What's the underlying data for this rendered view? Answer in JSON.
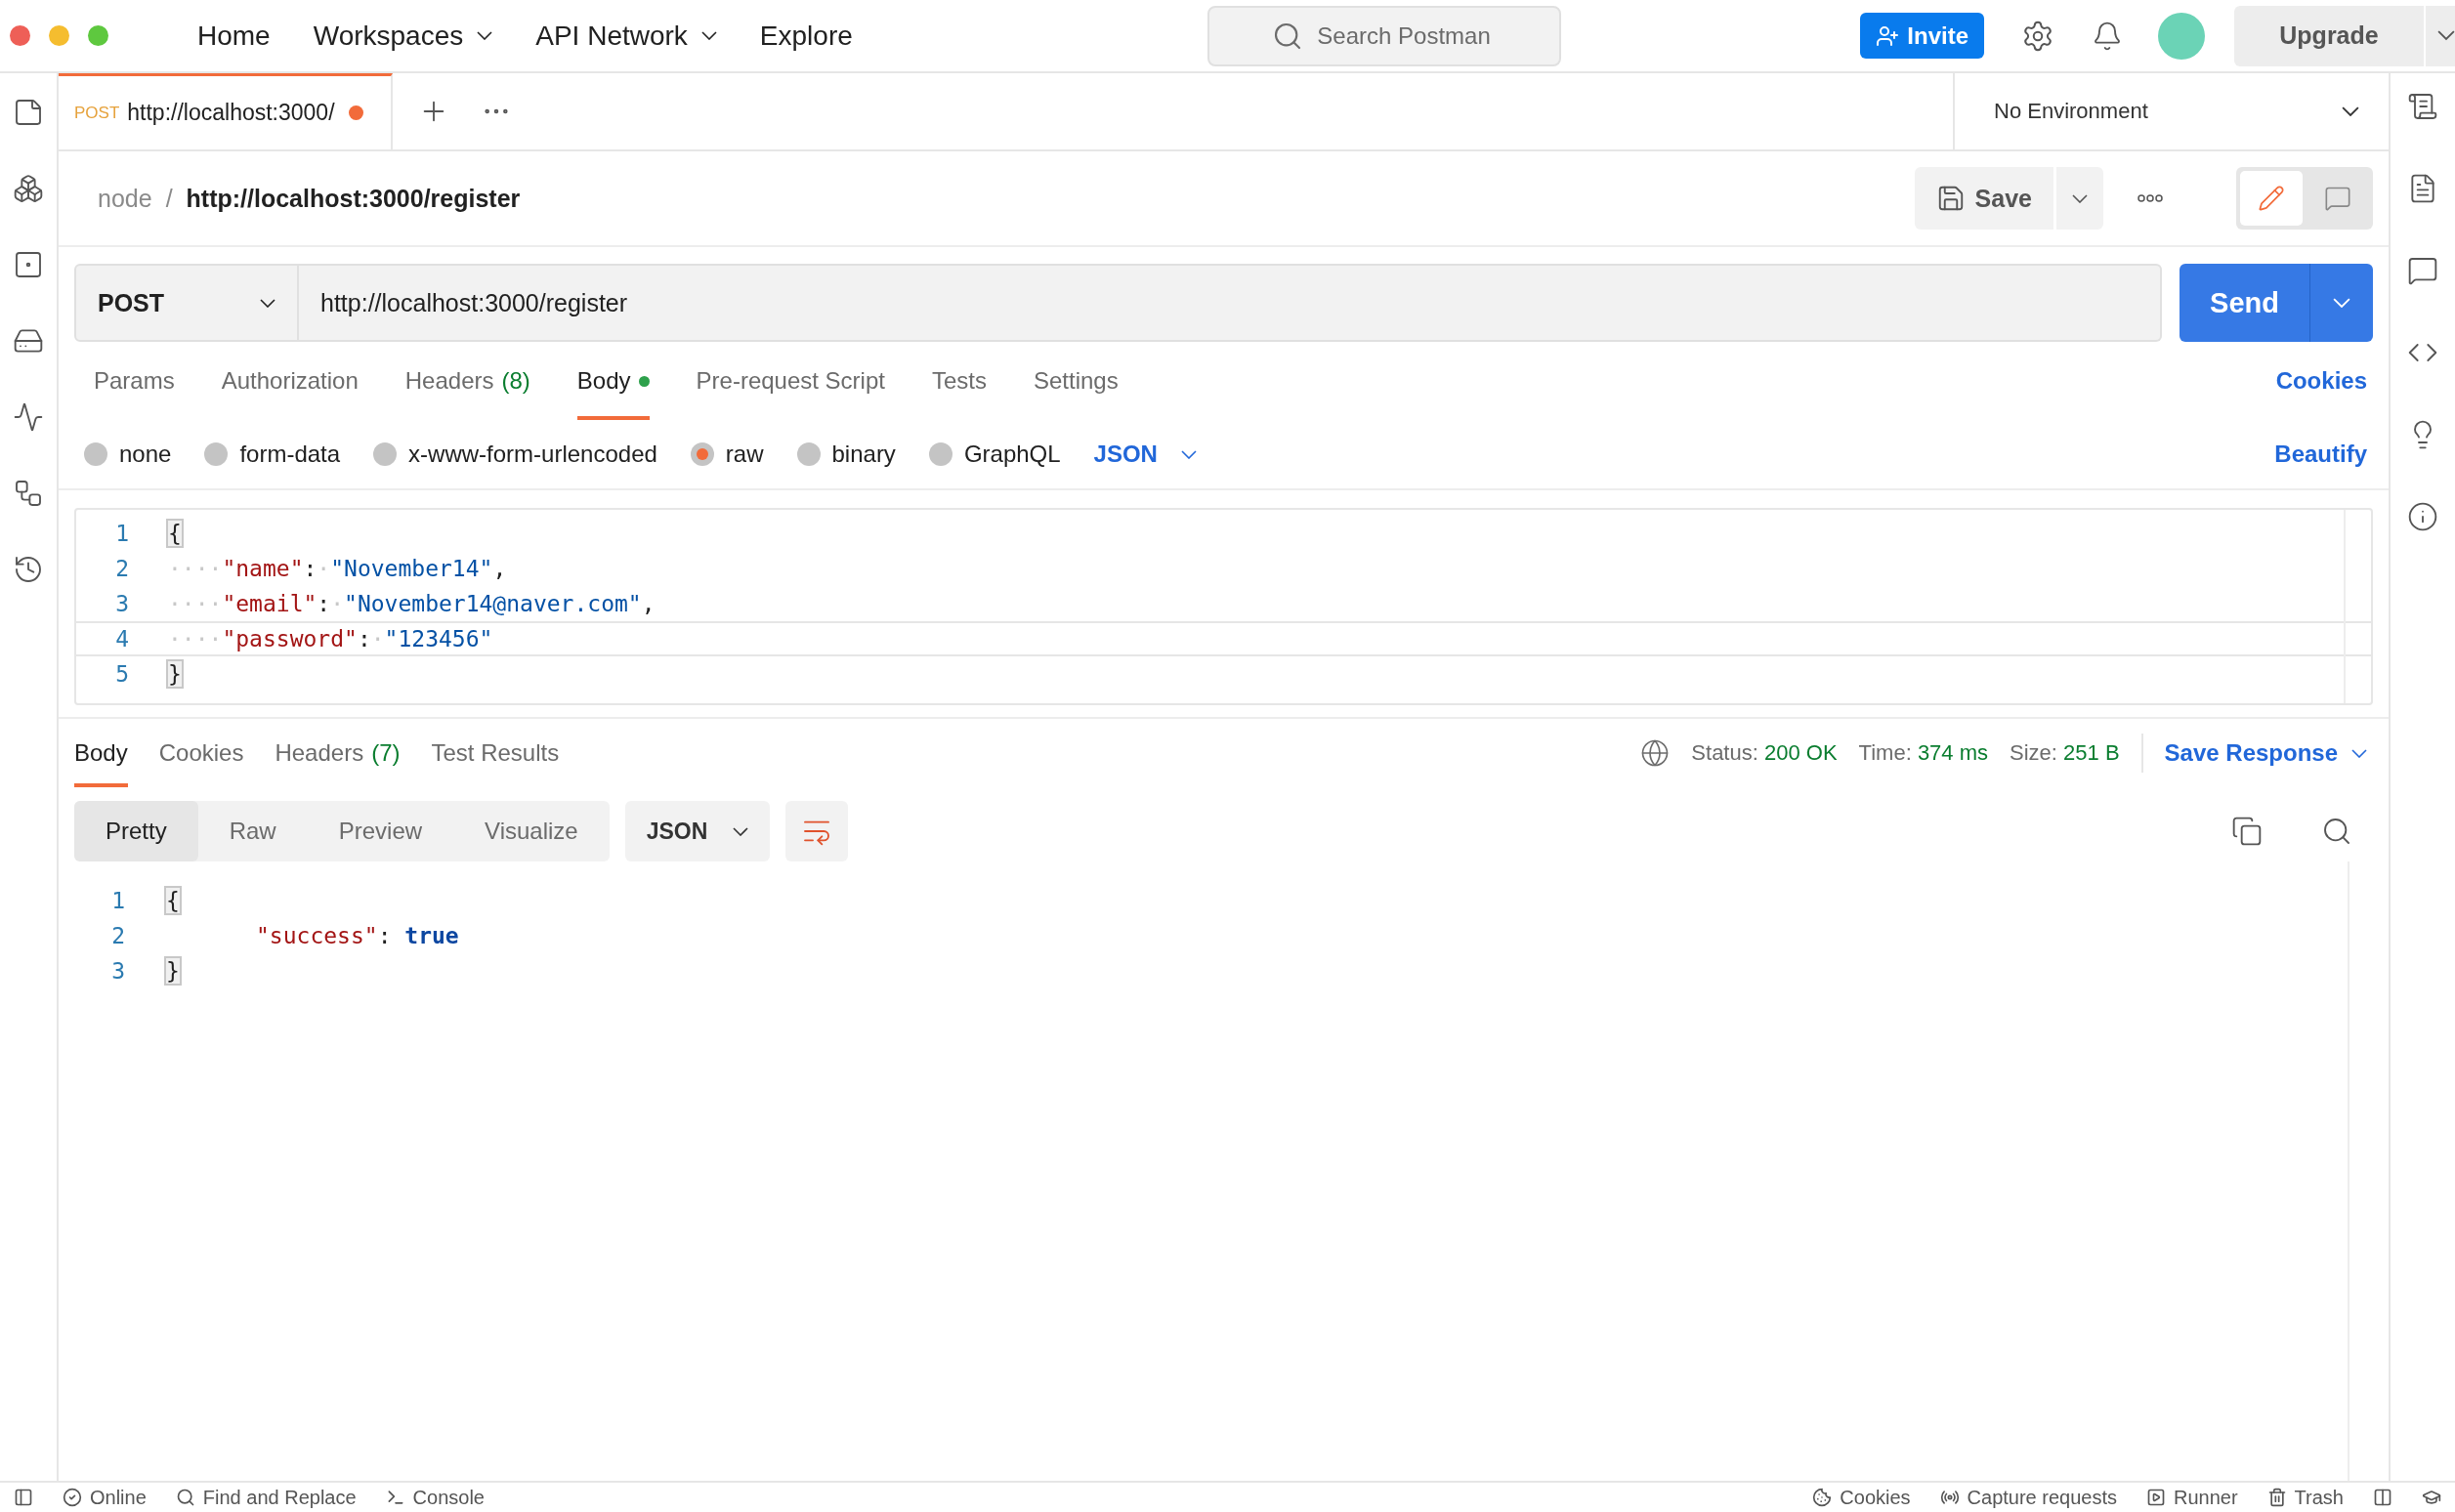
{
  "top_nav": {
    "items": [
      {
        "label": "Home",
        "dropdown": false
      },
      {
        "label": "Workspaces",
        "dropdown": true
      },
      {
        "label": "API Network",
        "dropdown": true
      },
      {
        "label": "Explore",
        "dropdown": false
      }
    ],
    "search": {
      "placeholder": "Search Postman"
    },
    "invite": "Invite",
    "upgrade": "Upgrade"
  },
  "tabs": [
    {
      "method": "POST",
      "title": "http://localhost:3000/",
      "unsaved": true,
      "selected": true
    }
  ],
  "environment": "No Environment",
  "breadcrumb": {
    "parent": "node",
    "separator": "/",
    "current": "http://localhost:3000/register"
  },
  "save": "Save",
  "request": {
    "method": "POST",
    "url": "http://localhost:3000/register",
    "send": "Send"
  },
  "request_tabs": [
    {
      "label": "Params",
      "selected": false
    },
    {
      "label": "Authorization",
      "selected": false
    },
    {
      "label": "Headers",
      "count": "(8)",
      "selected": false
    },
    {
      "label": "Body",
      "dot": true,
      "selected": true
    },
    {
      "label": "Pre-request Script",
      "selected": false
    },
    {
      "label": "Tests",
      "selected": false
    },
    {
      "label": "Settings",
      "selected": false
    }
  ],
  "cookies_link": "Cookies",
  "body_types": [
    {
      "label": "none",
      "selected": false
    },
    {
      "label": "form-data",
      "selected": false
    },
    {
      "label": "x-www-form-urlencoded",
      "selected": false
    },
    {
      "label": "raw",
      "selected": true
    },
    {
      "label": "binary",
      "selected": false
    },
    {
      "label": "GraphQL",
      "selected": false
    }
  ],
  "body_format": "JSON",
  "beautify": "Beautify",
  "request_body": [
    {
      "number": "1",
      "active": false,
      "tokens": [
        {
          "kind": "brace",
          "s": "{",
          "matched": true
        }
      ]
    },
    {
      "number": "2",
      "active": false,
      "tokens": [
        {
          "kind": "ws",
          "s": "····"
        },
        {
          "kind": "key",
          "s": "\"name\""
        },
        {
          "kind": "punct",
          "s": ":"
        },
        {
          "kind": "ws",
          "s": "·"
        },
        {
          "kind": "string",
          "s": "\"November14\""
        },
        {
          "kind": "punct",
          "s": ","
        }
      ]
    },
    {
      "number": "3",
      "active": false,
      "tokens": [
        {
          "kind": "ws",
          "s": "····"
        },
        {
          "kind": "key",
          "s": "\"email\""
        },
        {
          "kind": "punct",
          "s": ":"
        },
        {
          "kind": "ws",
          "s": "·"
        },
        {
          "kind": "string",
          "s": "\"November14@naver.com\""
        },
        {
          "kind": "punct",
          "s": ","
        }
      ]
    },
    {
      "number": "4",
      "active": true,
      "tokens": [
        {
          "kind": "ws",
          "s": "····"
        },
        {
          "kind": "key",
          "s": "\"password\""
        },
        {
          "kind": "punct",
          "s": ":"
        },
        {
          "kind": "ws",
          "s": "·"
        },
        {
          "kind": "string",
          "s": "\"123456\""
        }
      ]
    },
    {
      "number": "5",
      "active": false,
      "tokens": [
        {
          "kind": "brace",
          "s": "}",
          "matched": true
        }
      ]
    }
  ],
  "response_tabs": [
    {
      "label": "Body",
      "selected": true
    },
    {
      "label": "Cookies",
      "selected": false
    },
    {
      "label": "Headers",
      "count": "(7)",
      "selected": false
    },
    {
      "label": "Test Results",
      "selected": false
    }
  ],
  "response_meta": [
    {
      "label": "Status:",
      "value": "200 OK"
    },
    {
      "label": "Time:",
      "value": "374 ms"
    },
    {
      "label": "Size:",
      "value": "251 B"
    }
  ],
  "save_response": "Save Response",
  "view_modes": [
    {
      "label": "Pretty",
      "selected": true
    },
    {
      "label": "Raw",
      "selected": false
    },
    {
      "label": "Preview",
      "selected": false
    },
    {
      "label": "Visualize",
      "selected": false
    }
  ],
  "response_format": "JSON",
  "response_body": [
    {
      "number": "1",
      "active": false,
      "tokens": [
        {
          "kind": "brace",
          "s": "{",
          "matched": true
        }
      ]
    },
    {
      "number": "2",
      "active": false,
      "tokens": [
        {
          "kind": "indent"
        },
        {
          "kind": "key",
          "s": "\"success\""
        },
        {
          "kind": "punct",
          "s": ":"
        },
        {
          "kind": "space"
        },
        {
          "kind": "bool",
          "s": "true"
        }
      ]
    },
    {
      "number": "3",
      "active": false,
      "tokens": [
        {
          "kind": "brace",
          "s": "}",
          "matched": true
        }
      ]
    }
  ],
  "status_bar": {
    "left": [
      "Online",
      "Find and Replace",
      "Console"
    ],
    "right": [
      "Cookies",
      "Capture requests",
      "Runner",
      "Trash"
    ]
  }
}
